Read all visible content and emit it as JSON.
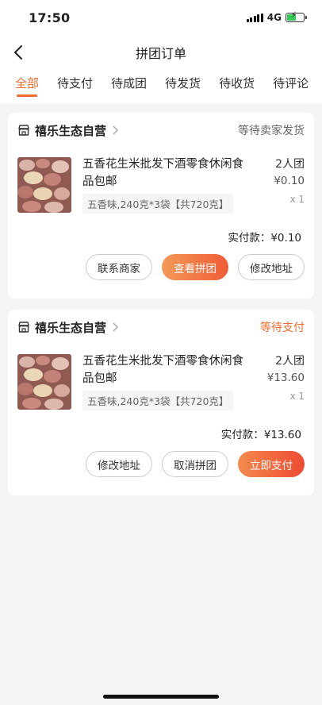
{
  "status_bar": {
    "time": "17:50",
    "network": "4G",
    "battery_level": 0.55
  },
  "nav": {
    "title": "拼团订单",
    "back_icon": "chevron-left-icon"
  },
  "tabs": [
    {
      "label": "全部",
      "active": true
    },
    {
      "label": "待支付"
    },
    {
      "label": "待成团"
    },
    {
      "label": "待发货"
    },
    {
      "label": "待收货"
    },
    {
      "label": "待评论"
    }
  ],
  "orders": [
    {
      "shop": "禧乐生态自营",
      "status": "等待卖家发货",
      "product": "五香花生米批发下酒零食休闲食品包邮",
      "spec": "五香味,240克*3袋【共720克】",
      "group": "2人团",
      "price": "¥0.10",
      "qty": "x 1",
      "paid": "实付款：¥0.10",
      "buttons": [
        "联系商家",
        "查看拼团",
        "修改地址"
      ]
    },
    {
      "shop": "禧乐生态自营",
      "status": "等待支付",
      "product": "五香花生米批发下酒零食休闲食品包邮",
      "spec": "五香味,240克*3袋【共720克】",
      "group": "2人团",
      "price": "¥13.60",
      "qty": "x 1",
      "paid": "实付款：¥13.60",
      "buttons": [
        "修改地址",
        "取消拼团",
        "立即支付"
      ]
    }
  ],
  "colors": {
    "accent": "#f06b2c",
    "pay_gradient_start": "#f59a56",
    "pay_gradient_end": "#ef5b36"
  }
}
